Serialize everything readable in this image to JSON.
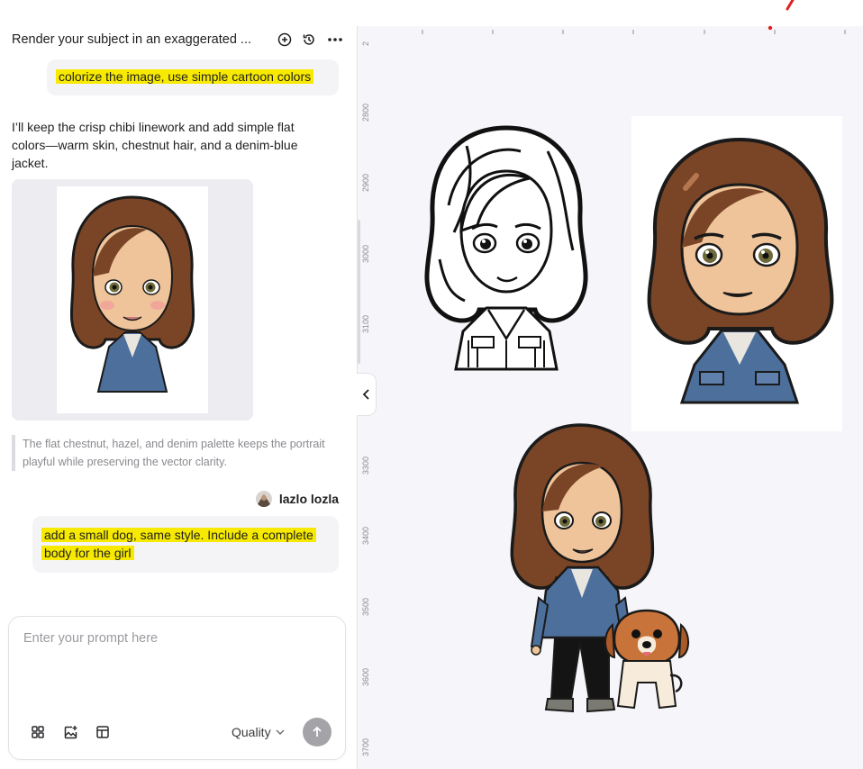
{
  "chat": {
    "title": "Render your subject in an exaggerated ...",
    "header_icons": [
      "add-chat-icon",
      "history-icon",
      "more-icon"
    ],
    "messages": {
      "user1": "colorize the image, use simple cartoon colors",
      "assistant": "I’ll keep the crisp chibi linework and add simple flat colors—warm skin, chestnut hair, and a denim-blue jacket.",
      "quote": "The flat chestnut, hazel, and denim palette keeps the portrait playful while preserving the vector clarity.",
      "user_name": "lazlo lozla",
      "user2": "add a small dog, same style. Include a complete body for the girl"
    },
    "prompt": {
      "placeholder": "Enter your prompt here",
      "quality_label": "Quality",
      "tool_icons": [
        "grid-icon",
        "add-image-icon",
        "layout-icon"
      ]
    }
  },
  "canvas": {
    "ruler_top_label": "2",
    "ruler_left_labels": [
      "2800",
      "2900",
      "3000",
      "3100",
      "3300",
      "3400",
      "3500",
      "3600",
      "3700"
    ]
  },
  "colors": {
    "highlight": "#f7ea00",
    "hair": "#7a4526",
    "skin": "#efc49a",
    "denim": "#4d6f9b",
    "canvas_bg": "#f6f6fa"
  }
}
